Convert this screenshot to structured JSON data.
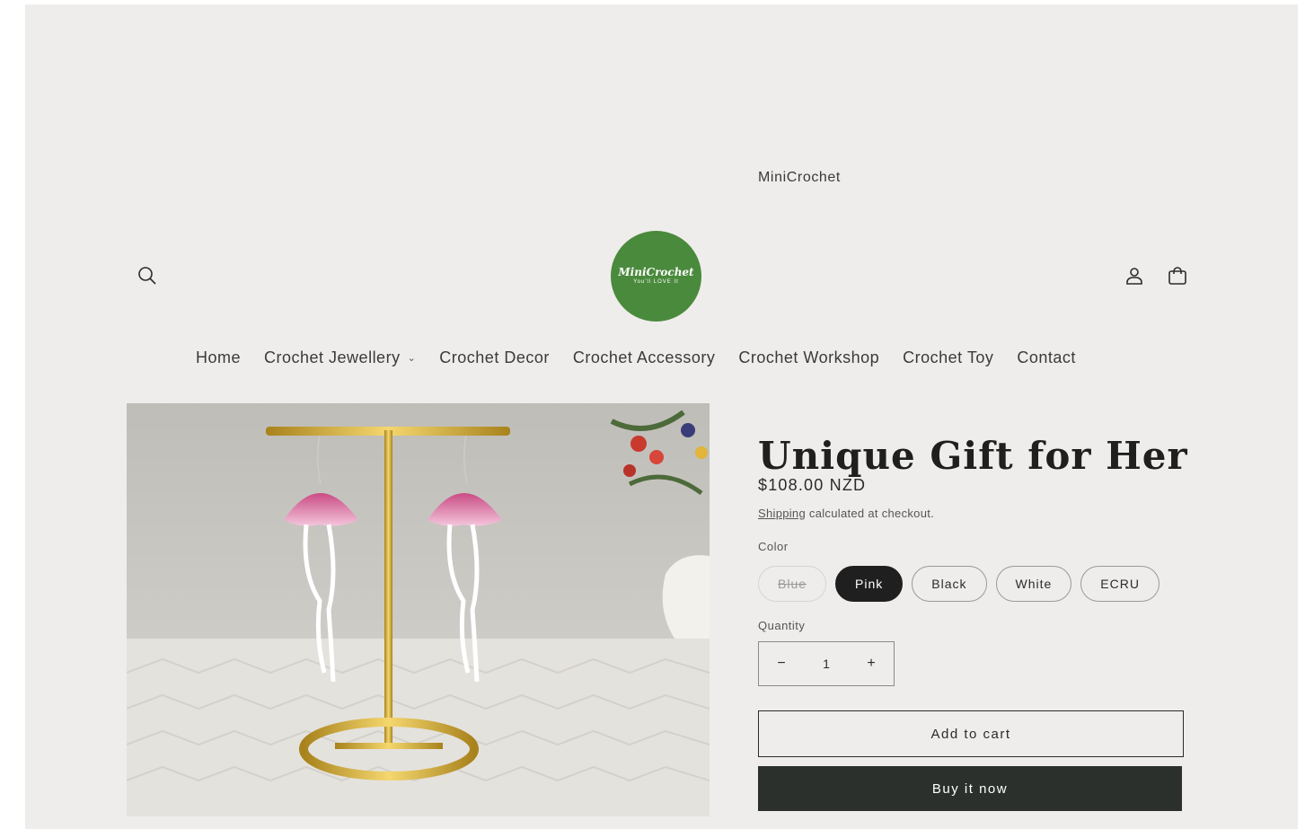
{
  "announcement": "MiniCrochet",
  "header": {
    "logo_text": "MiniCrochet",
    "logo_sub": "You'll LOVE It"
  },
  "nav": [
    {
      "label": "Home"
    },
    {
      "label": "Crochet Jewellery",
      "dropdown": true
    },
    {
      "label": "Crochet Decor"
    },
    {
      "label": "Crochet Accessory"
    },
    {
      "label": "Crochet Workshop"
    },
    {
      "label": "Crochet Toy"
    },
    {
      "label": "Contact"
    }
  ],
  "product": {
    "title": "Unique Gift for Her",
    "price": "$108.00 NZD",
    "shipping_link": "Shipping",
    "shipping_text": " calculated at checkout.",
    "color_label": "Color",
    "colors": [
      "Blue",
      "Pink",
      "Black",
      "White",
      "ECRU"
    ],
    "selected_color": "Pink",
    "unavailable_colors": [
      "Blue"
    ],
    "quantity_label": "Quantity",
    "quantity": "1",
    "decrement": "−",
    "increment": "+",
    "add_to_cart": "Add to cart",
    "buy_now": "Buy it now"
  },
  "colors": {
    "background": "#efedeb",
    "logo_green": "#4a8a3c",
    "primary_button": "#2b302d"
  },
  "icons": [
    "search-icon",
    "account-icon",
    "cart-icon",
    "chevron-down-icon"
  ]
}
